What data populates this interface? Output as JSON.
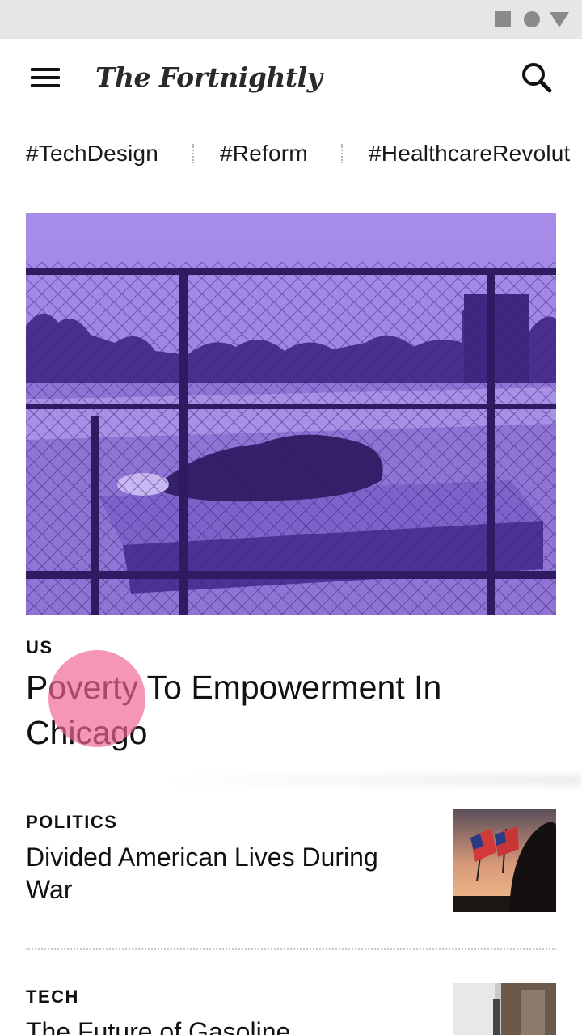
{
  "status_bar": {
    "icons": [
      "square-icon",
      "circle-icon",
      "triangle-icon"
    ],
    "color": "#8a8a8a"
  },
  "app_bar": {
    "menu_icon": "hamburger-menu-icon",
    "logo": "The Fortnightly",
    "search_icon": "search-icon"
  },
  "tags": [
    "#TechDesign",
    "#Reform",
    "#HealthcareRevolut"
  ],
  "hero": {
    "category": "US",
    "title": "Poverty To Empowerment In Chicago",
    "image_tint": "#6a4bc4"
  },
  "stories": [
    {
      "category": "POLITICS",
      "title": "Divided American Lives During War"
    },
    {
      "category": "TECH",
      "title": "The Future of Gasoline"
    }
  ],
  "touch_indicator_color": "#f06496"
}
